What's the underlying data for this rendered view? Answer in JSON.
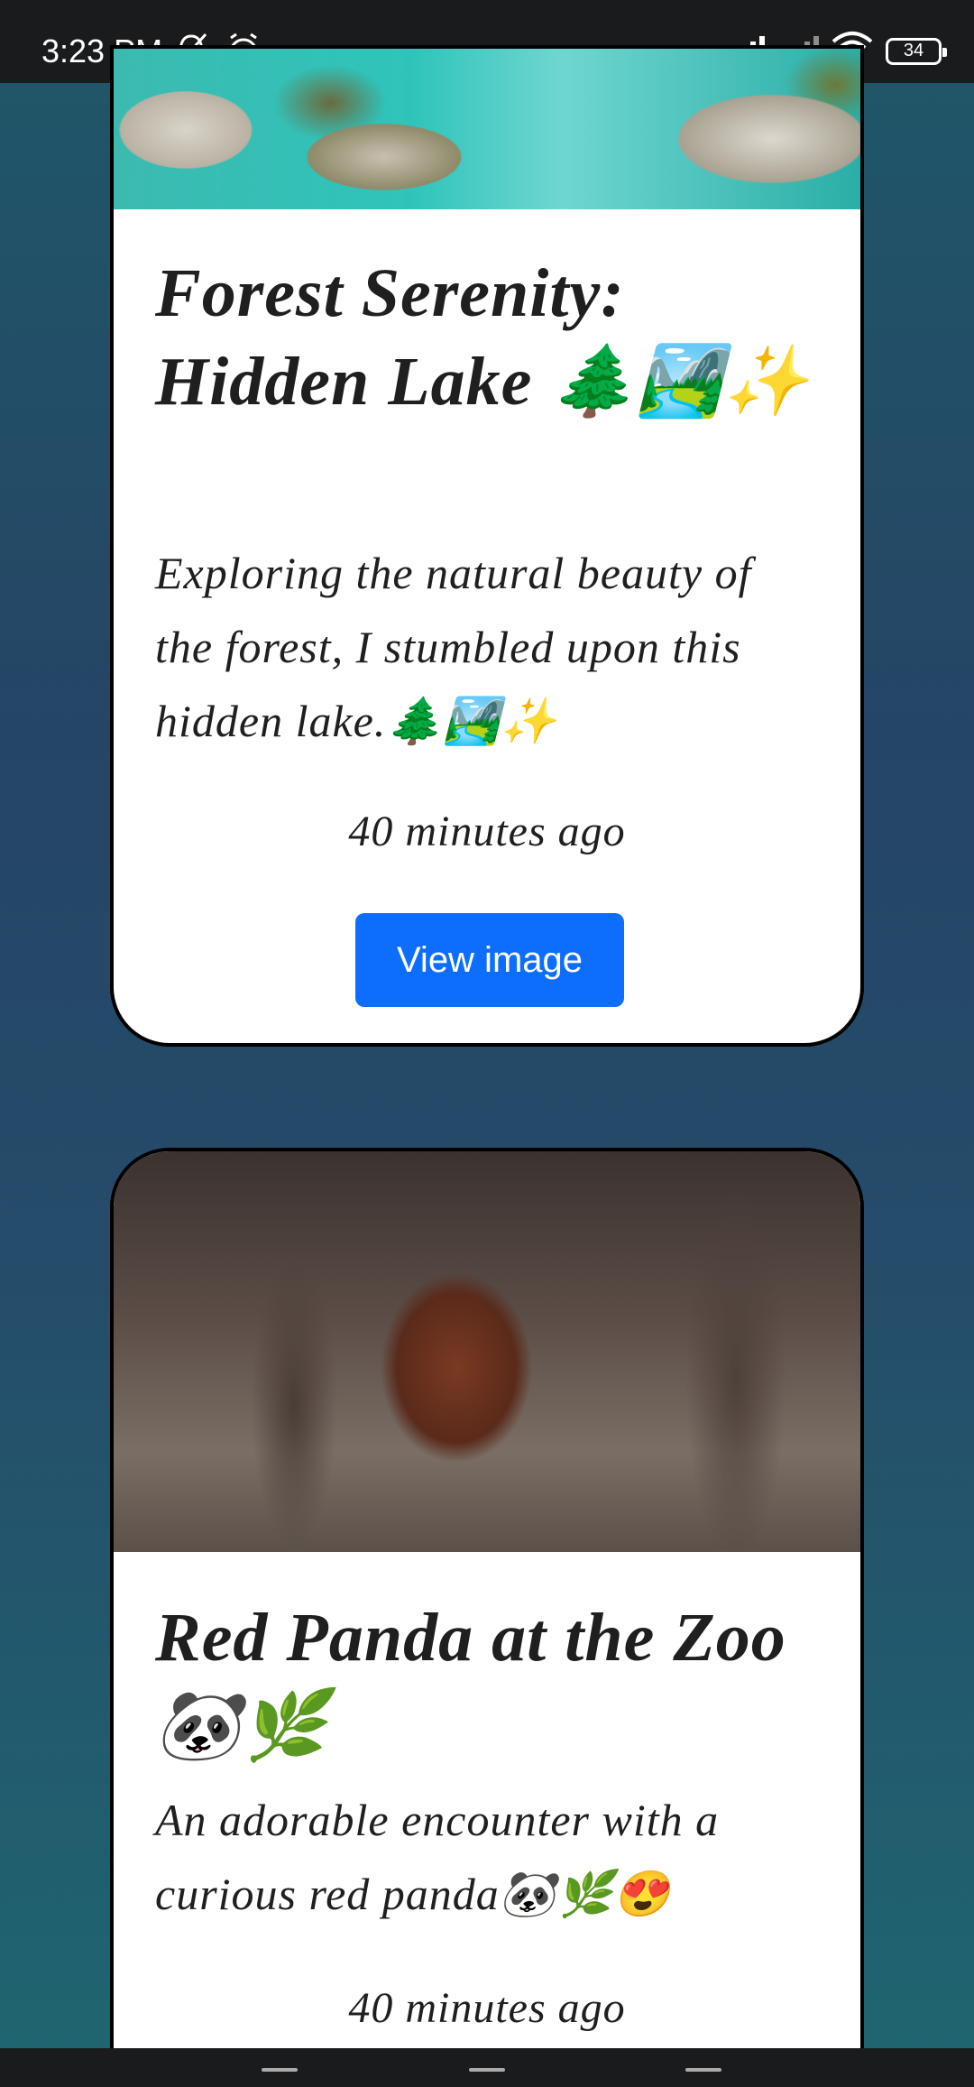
{
  "status_bar": {
    "time": "3:23 PM",
    "battery_level": "34",
    "icons": [
      "muted-bell-icon",
      "alarm-icon",
      "signal-icon",
      "signal-icon",
      "wifi-icon",
      "battery-icon"
    ]
  },
  "posts": [
    {
      "title": "Forest Serenity: Hidden Lake 🌲🏞️✨",
      "description": "Exploring the natural beauty of the forest, I stumbled upon this hidden lake.🌲🏞️✨",
      "time": "40 minutes ago",
      "button_label": "View image"
    },
    {
      "title": "Red Panda at the Zoo 🐼🌿",
      "description": "An adorable encounter with a curious red panda🐼🌿😍",
      "time": "40 minutes ago"
    }
  ],
  "colors": {
    "button": "#0d6efd",
    "card_background": "#ffffff",
    "card_border": "#000000",
    "status_bar": "#1a1b1d"
  }
}
